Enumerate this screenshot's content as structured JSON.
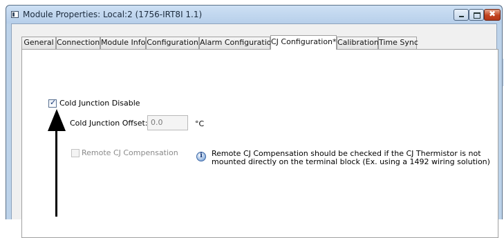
{
  "window": {
    "title": "Module Properties: Local:2 (1756-IRT8I 1.1)",
    "buttons": {
      "minimize": "minimize",
      "maximize": "maximize",
      "close": "✖"
    }
  },
  "tabs": [
    {
      "label": "General"
    },
    {
      "label": "Connection"
    },
    {
      "label": "Module Info"
    },
    {
      "label": "Configuration"
    },
    {
      "label": "Alarm Configuration"
    },
    {
      "label": "CJ Configuration*",
      "active": true
    },
    {
      "label": "Calibration"
    },
    {
      "label": "Time Sync"
    }
  ],
  "cj": {
    "disable_label": "Cold Junction Disable",
    "disable_checked": true,
    "offset_label": "Cold Junction Offset:",
    "offset_value": "0.0",
    "offset_unit": "°C",
    "remote_label": "Remote CJ Compensation",
    "remote_checked": false,
    "info_line1": "Remote CJ Compensation should be checked if the CJ Thermistor is not",
    "info_line2": "mounted directly on the terminal block (Ex. using a 1492 wiring solution)"
  },
  "colors": {
    "window_frame": "#bdd3ea",
    "close_button": "#c3431f",
    "annotation_arrow": "#000000"
  }
}
